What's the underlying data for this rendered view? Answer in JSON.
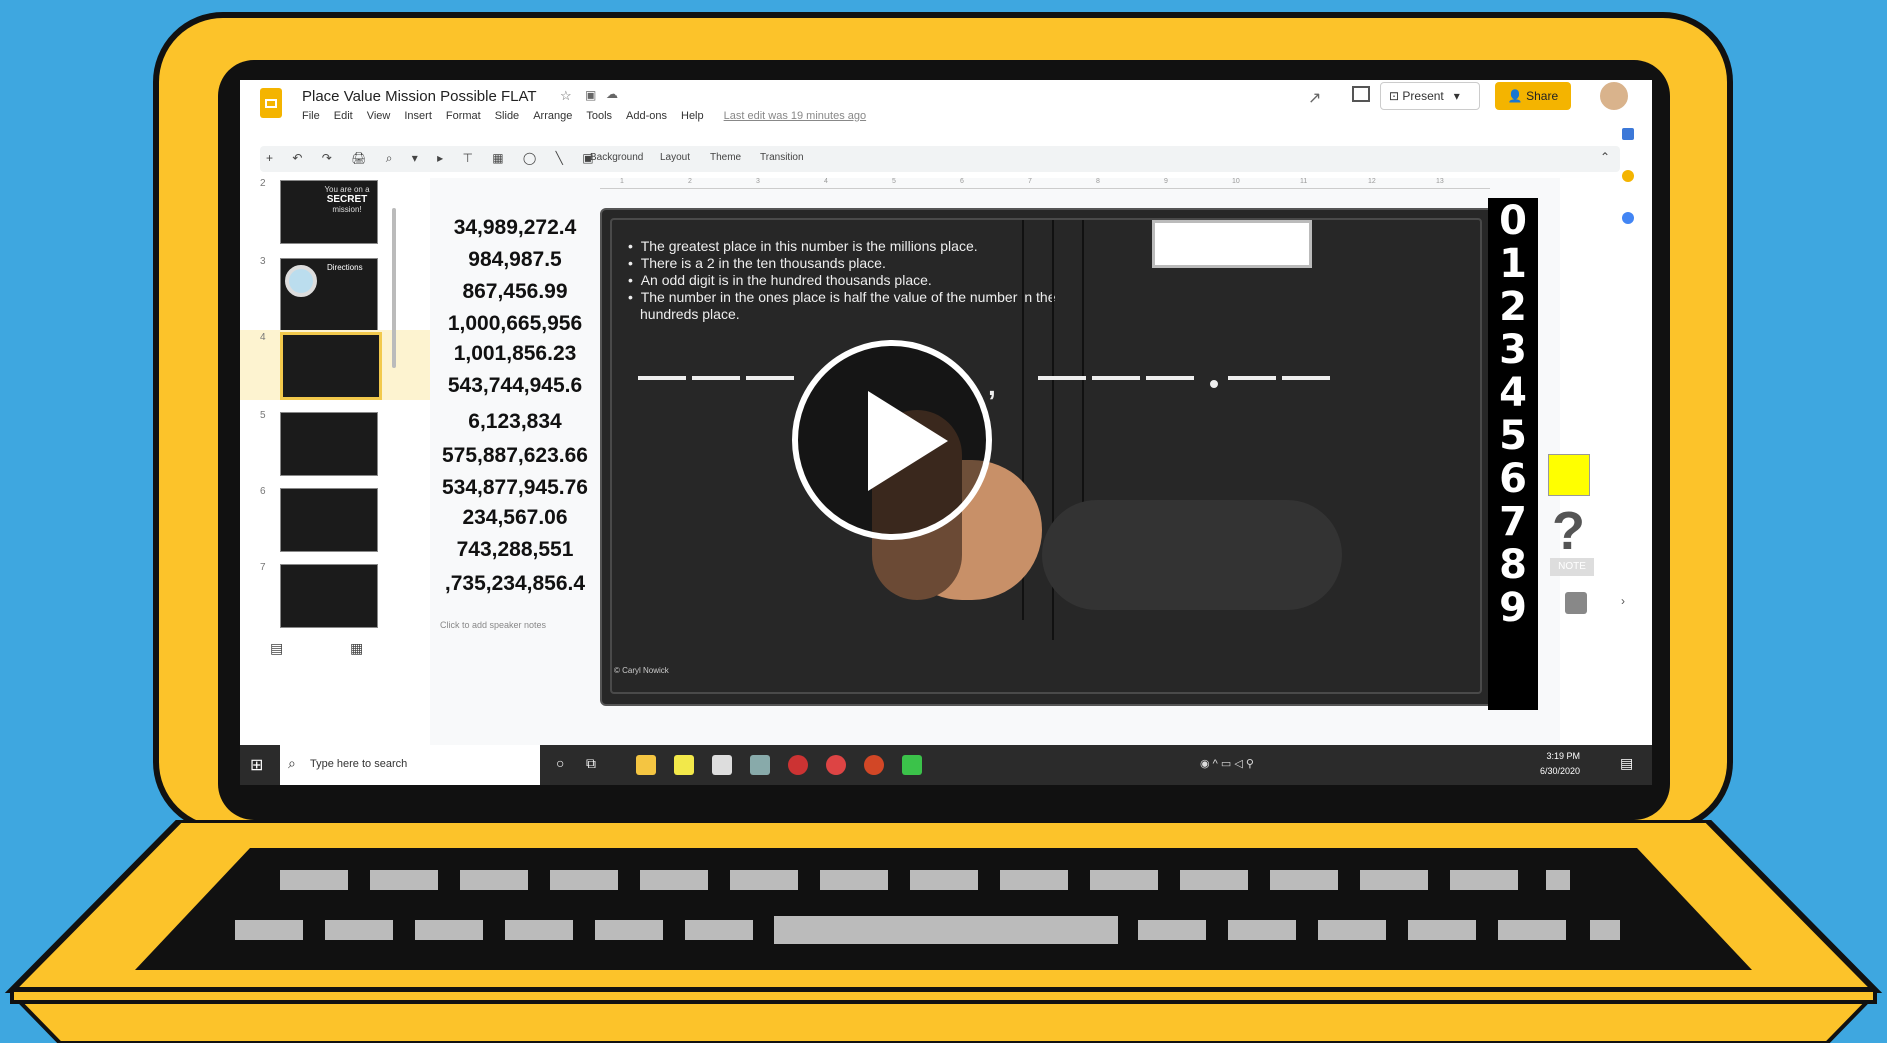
{
  "doc": {
    "title": "Place Value Mission Possible FLAT",
    "last_edit": "Last edit was 19 minutes ago",
    "menu": [
      "File",
      "Edit",
      "View",
      "Insert",
      "Format",
      "Slide",
      "Arrange",
      "Tools",
      "Add-ons",
      "Help"
    ],
    "present_label": "Present",
    "share_label": "Share"
  },
  "toolbar": {
    "background_label": "Background",
    "layout_label": "Layout",
    "theme_label": "Theme",
    "transition_label": "Transition"
  },
  "filmstrip": {
    "numbers": [
      "2",
      "3",
      "4",
      "5",
      "6",
      "7"
    ],
    "first_thumb_text": [
      "You are on a",
      "SECRET",
      "mission!"
    ],
    "second_thumb_title": "Directions"
  },
  "numbers": [
    "34,989,272.4",
    "984,987.5",
    "867,456.99",
    "1,000,665,956",
    "1,001,856.23",
    "543,744,945.6",
    "6,123,834",
    "575,887,623.66",
    "534,877,945.76",
    "234,567.06",
    "743,288,551",
    ",735,234,856.4"
  ],
  "slide": {
    "bullets": [
      "The greatest place in this number is the millions place.",
      "There is a 2 in the ten thousands place.",
      "An odd digit is in the hundred thousands place.",
      "The number in the ones place is half the value of the number in the hundreds place."
    ],
    "credit": "© Caryl Nowick"
  },
  "digits": [
    "0",
    "1",
    "2",
    "3",
    "4",
    "5",
    "6",
    "7",
    "8",
    "9"
  ],
  "side": {
    "question_mark": "?",
    "note_label": "NOTE"
  },
  "ruler": [
    "1",
    "2",
    "3",
    "4",
    "5",
    "6",
    "7",
    "8",
    "9",
    "10",
    "11",
    "12",
    "13"
  ],
  "speaker_notes": "Click to add speaker notes",
  "taskbar": {
    "search_placeholder": "Type here to search",
    "time": "3:19 PM",
    "date": "6/30/2020"
  },
  "colors": {
    "laptop_yellow": "#fcc32a",
    "background_blue": "#3ea7e0",
    "share_button": "#f4b400",
    "note_yellow": "#ffff00"
  }
}
